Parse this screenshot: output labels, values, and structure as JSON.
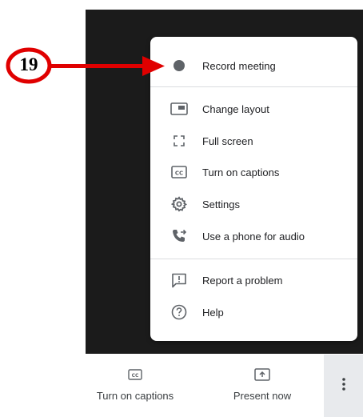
{
  "menu": {
    "items": [
      {
        "label": "Record meeting",
        "icon": "record-dot-icon"
      },
      {
        "label": "Change layout",
        "icon": "layout-icon"
      },
      {
        "label": "Full screen",
        "icon": "fullscreen-icon"
      },
      {
        "label": "Turn on captions",
        "icon": "captions-icon"
      },
      {
        "label": "Settings",
        "icon": "gear-icon"
      },
      {
        "label": "Use a phone for audio",
        "icon": "phone-icon"
      },
      {
        "label": "Report a problem",
        "icon": "report-icon"
      },
      {
        "label": "Help",
        "icon": "help-icon"
      }
    ]
  },
  "annotation": {
    "step_number": "19",
    "color": "#e00000"
  },
  "bottom_bar": {
    "captions_label": "Turn on captions",
    "present_label": "Present now",
    "more_icon": "more-vert-icon"
  },
  "colors": {
    "video_bg": "#1b1b1b",
    "menu_bg": "#ffffff",
    "text": "#202124",
    "icon": "#5f6368"
  }
}
